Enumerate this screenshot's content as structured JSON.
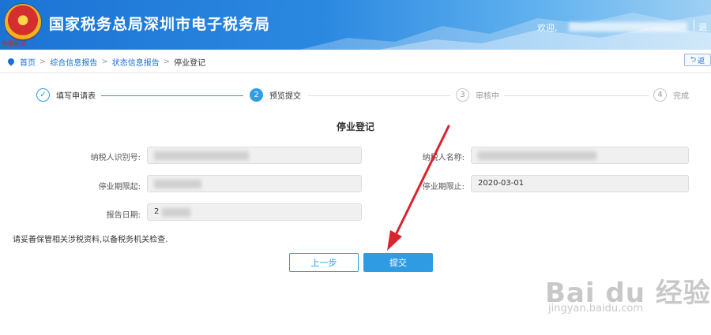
{
  "header": {
    "title": "国家税务总局深圳市电子税务局",
    "emblem_text": "中国税务",
    "welcome": "欢迎,",
    "logout": "退"
  },
  "breadcrumb": {
    "items": [
      "首页",
      "综合信息报告",
      "状态信息报告",
      "停业登记"
    ],
    "back_label": "返"
  },
  "steps": [
    {
      "num": "✓",
      "label": "填写申请表",
      "state": "done"
    },
    {
      "num": "2",
      "label": "预览提交",
      "state": "active"
    },
    {
      "num": "3",
      "label": "审核中",
      "state": "pending"
    },
    {
      "num": "4",
      "label": "完成",
      "state": "pending"
    }
  ],
  "form": {
    "title": "停业登记",
    "taxpayer_id_label": "纳税人识别号:",
    "taxpayer_name_label": "纳税人名称:",
    "start_label": "停业期限起:",
    "end_label": "停业期限止:",
    "end_value": "2020-03-01",
    "report_date_label": "报告日期:",
    "report_date_prefix": "2"
  },
  "notice": "请妥善保管相关涉税资料,以备税务机关检查.",
  "buttons": {
    "prev": "上一步",
    "submit": "提交"
  },
  "watermark": {
    "main": "Bai du 经验",
    "sub": "jingyan.baidu.com"
  },
  "colors": {
    "header_blue": "#1c73d4",
    "accent": "#2f9de4",
    "arrow": "#d9232d"
  }
}
